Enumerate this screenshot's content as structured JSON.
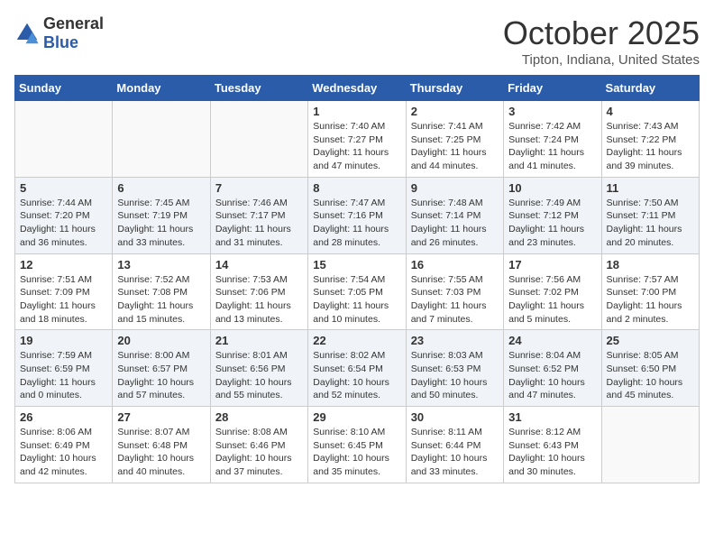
{
  "header": {
    "logo_general": "General",
    "logo_blue": "Blue",
    "month_title": "October 2025",
    "location": "Tipton, Indiana, United States"
  },
  "weekdays": [
    "Sunday",
    "Monday",
    "Tuesday",
    "Wednesday",
    "Thursday",
    "Friday",
    "Saturday"
  ],
  "weeks": [
    [
      {
        "day": "",
        "info": ""
      },
      {
        "day": "",
        "info": ""
      },
      {
        "day": "",
        "info": ""
      },
      {
        "day": "1",
        "info": "Sunrise: 7:40 AM\nSunset: 7:27 PM\nDaylight: 11 hours and 47 minutes."
      },
      {
        "day": "2",
        "info": "Sunrise: 7:41 AM\nSunset: 7:25 PM\nDaylight: 11 hours and 44 minutes."
      },
      {
        "day": "3",
        "info": "Sunrise: 7:42 AM\nSunset: 7:24 PM\nDaylight: 11 hours and 41 minutes."
      },
      {
        "day": "4",
        "info": "Sunrise: 7:43 AM\nSunset: 7:22 PM\nDaylight: 11 hours and 39 minutes."
      }
    ],
    [
      {
        "day": "5",
        "info": "Sunrise: 7:44 AM\nSunset: 7:20 PM\nDaylight: 11 hours and 36 minutes."
      },
      {
        "day": "6",
        "info": "Sunrise: 7:45 AM\nSunset: 7:19 PM\nDaylight: 11 hours and 33 minutes."
      },
      {
        "day": "7",
        "info": "Sunrise: 7:46 AM\nSunset: 7:17 PM\nDaylight: 11 hours and 31 minutes."
      },
      {
        "day": "8",
        "info": "Sunrise: 7:47 AM\nSunset: 7:16 PM\nDaylight: 11 hours and 28 minutes."
      },
      {
        "day": "9",
        "info": "Sunrise: 7:48 AM\nSunset: 7:14 PM\nDaylight: 11 hours and 26 minutes."
      },
      {
        "day": "10",
        "info": "Sunrise: 7:49 AM\nSunset: 7:12 PM\nDaylight: 11 hours and 23 minutes."
      },
      {
        "day": "11",
        "info": "Sunrise: 7:50 AM\nSunset: 7:11 PM\nDaylight: 11 hours and 20 minutes."
      }
    ],
    [
      {
        "day": "12",
        "info": "Sunrise: 7:51 AM\nSunset: 7:09 PM\nDaylight: 11 hours and 18 minutes."
      },
      {
        "day": "13",
        "info": "Sunrise: 7:52 AM\nSunset: 7:08 PM\nDaylight: 11 hours and 15 minutes."
      },
      {
        "day": "14",
        "info": "Sunrise: 7:53 AM\nSunset: 7:06 PM\nDaylight: 11 hours and 13 minutes."
      },
      {
        "day": "15",
        "info": "Sunrise: 7:54 AM\nSunset: 7:05 PM\nDaylight: 11 hours and 10 minutes."
      },
      {
        "day": "16",
        "info": "Sunrise: 7:55 AM\nSunset: 7:03 PM\nDaylight: 11 hours and 7 minutes."
      },
      {
        "day": "17",
        "info": "Sunrise: 7:56 AM\nSunset: 7:02 PM\nDaylight: 11 hours and 5 minutes."
      },
      {
        "day": "18",
        "info": "Sunrise: 7:57 AM\nSunset: 7:00 PM\nDaylight: 11 hours and 2 minutes."
      }
    ],
    [
      {
        "day": "19",
        "info": "Sunrise: 7:59 AM\nSunset: 6:59 PM\nDaylight: 11 hours and 0 minutes."
      },
      {
        "day": "20",
        "info": "Sunrise: 8:00 AM\nSunset: 6:57 PM\nDaylight: 10 hours and 57 minutes."
      },
      {
        "day": "21",
        "info": "Sunrise: 8:01 AM\nSunset: 6:56 PM\nDaylight: 10 hours and 55 minutes."
      },
      {
        "day": "22",
        "info": "Sunrise: 8:02 AM\nSunset: 6:54 PM\nDaylight: 10 hours and 52 minutes."
      },
      {
        "day": "23",
        "info": "Sunrise: 8:03 AM\nSunset: 6:53 PM\nDaylight: 10 hours and 50 minutes."
      },
      {
        "day": "24",
        "info": "Sunrise: 8:04 AM\nSunset: 6:52 PM\nDaylight: 10 hours and 47 minutes."
      },
      {
        "day": "25",
        "info": "Sunrise: 8:05 AM\nSunset: 6:50 PM\nDaylight: 10 hours and 45 minutes."
      }
    ],
    [
      {
        "day": "26",
        "info": "Sunrise: 8:06 AM\nSunset: 6:49 PM\nDaylight: 10 hours and 42 minutes."
      },
      {
        "day": "27",
        "info": "Sunrise: 8:07 AM\nSunset: 6:48 PM\nDaylight: 10 hours and 40 minutes."
      },
      {
        "day": "28",
        "info": "Sunrise: 8:08 AM\nSunset: 6:46 PM\nDaylight: 10 hours and 37 minutes."
      },
      {
        "day": "29",
        "info": "Sunrise: 8:10 AM\nSunset: 6:45 PM\nDaylight: 10 hours and 35 minutes."
      },
      {
        "day": "30",
        "info": "Sunrise: 8:11 AM\nSunset: 6:44 PM\nDaylight: 10 hours and 33 minutes."
      },
      {
        "day": "31",
        "info": "Sunrise: 8:12 AM\nSunset: 6:43 PM\nDaylight: 10 hours and 30 minutes."
      },
      {
        "day": "",
        "info": ""
      }
    ]
  ]
}
